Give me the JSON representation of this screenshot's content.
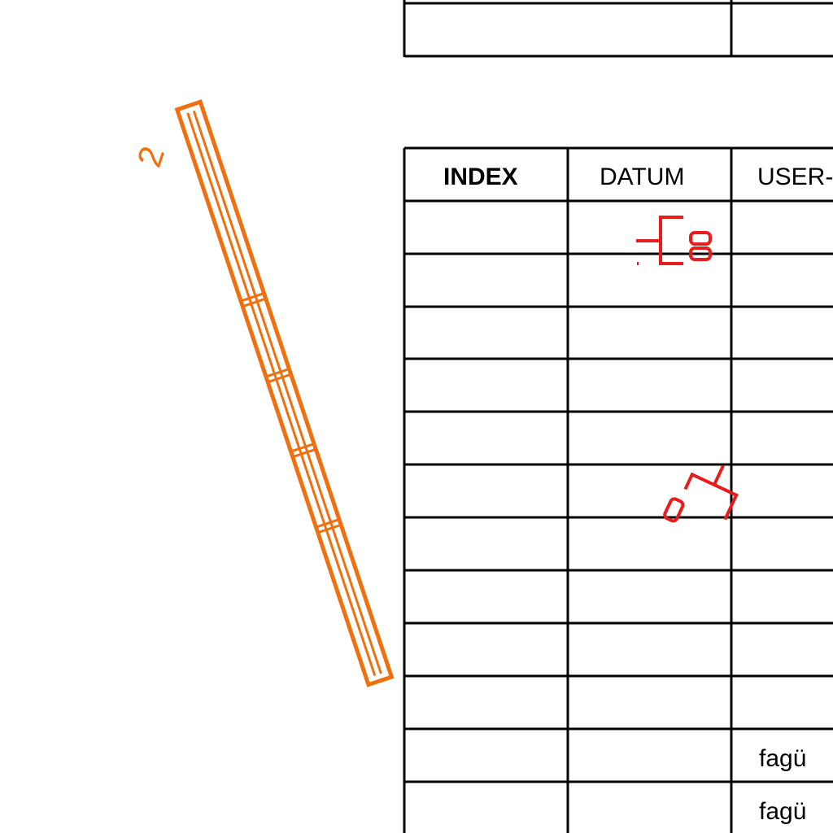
{
  "colors": {
    "line": "#000000",
    "element": "#f07010",
    "tag": "#e81c1c",
    "background": "#ffffff"
  },
  "element_tag": "2",
  "table": {
    "headers": [
      "INDEX",
      "DATUM",
      "USER-"
    ],
    "rows": [
      [
        "",
        "",
        ""
      ],
      [
        "",
        "",
        ""
      ],
      [
        "",
        "",
        ""
      ],
      [
        "",
        "",
        ""
      ],
      [
        "",
        "",
        ""
      ],
      [
        "",
        "",
        ""
      ],
      [
        "",
        "",
        ""
      ],
      [
        "",
        "",
        ""
      ],
      [
        "",
        "",
        ""
      ],
      [
        "",
        "",
        ""
      ],
      [
        "",
        "",
        "fagü"
      ],
      [
        "",
        "",
        "fagü"
      ]
    ]
  }
}
